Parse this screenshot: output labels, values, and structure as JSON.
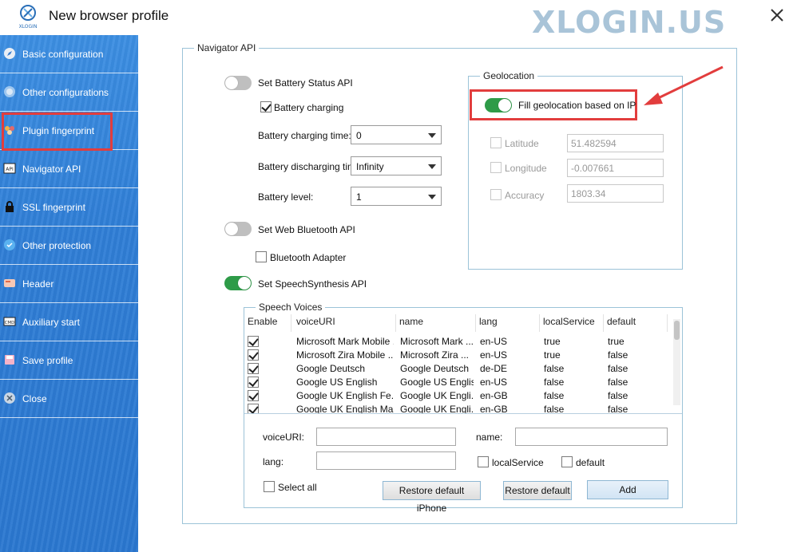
{
  "window": {
    "title": "New browser profile",
    "brand": "XLOGIN.US",
    "logo_text": "XLOGIN"
  },
  "sidebar": {
    "items": [
      {
        "label": "Basic configuration",
        "icon": "compass-icon"
      },
      {
        "label": "Other configurations",
        "icon": "puzzle-icon"
      },
      {
        "label": "Plugin fingerprint",
        "icon": "plugin-icon"
      },
      {
        "label": "Navigator API",
        "icon": "api-icon"
      },
      {
        "label": "SSL fingerprint",
        "icon": "lock-icon"
      },
      {
        "label": "Other protection",
        "icon": "shield-icon"
      },
      {
        "label": "Header",
        "icon": "header-icon"
      },
      {
        "label": "Auxiliary start",
        "icon": "cmd-icon"
      },
      {
        "label": "Save profile",
        "icon": "save-icon"
      },
      {
        "label": "Close",
        "icon": "close-icon"
      }
    ],
    "active": "Navigator API"
  },
  "navigator": {
    "legend": "Navigator API",
    "battery_status_label": "Set Battery Status API",
    "battery_status_on": false,
    "battery_charging_label": "Battery charging",
    "battery_charging_checked": true,
    "charging_time_label": "Battery charging time:",
    "charging_time_value": "0",
    "discharging_time_label": "Battery discharging time",
    "discharging_time_value": "Infinity",
    "battery_level_label": "Battery level:",
    "battery_level_value": "1",
    "bluetooth_label": "Set Web Bluetooth API",
    "bluetooth_on": false,
    "bluetooth_adapter_label": "Bluetooth Adapter",
    "bluetooth_adapter_checked": false,
    "speech_label": "Set SpeechSynthesis API",
    "speech_on": true
  },
  "geolocation": {
    "legend": "Geolocation",
    "fill_label": "Fill geolocation based on IP",
    "fill_on": true,
    "latitude_label": "Latitude",
    "latitude_value": "51.482594",
    "longitude_label": "Longitude",
    "longitude_value": "-0.007661",
    "accuracy_label": "Accuracy",
    "accuracy_value": "1803.34"
  },
  "voices": {
    "legend": "Speech Voices",
    "columns": [
      "Enable",
      "voiceURI",
      "name",
      "lang",
      "localService",
      "default"
    ],
    "rows": [
      {
        "enabled": true,
        "voiceURI": "Microsoft Mark Mobile ...",
        "name": "Microsoft Mark ...",
        "lang": "en-US",
        "localService": "true",
        "default": "true"
      },
      {
        "enabled": true,
        "voiceURI": "Microsoft Zira Mobile ...",
        "name": "Microsoft Zira ...",
        "lang": "en-US",
        "localService": "true",
        "default": "false"
      },
      {
        "enabled": true,
        "voiceURI": "Google Deutsch",
        "name": "Google Deutsch",
        "lang": "de-DE",
        "localService": "false",
        "default": "false"
      },
      {
        "enabled": true,
        "voiceURI": "Google US English",
        "name": "Google US English",
        "lang": "en-US",
        "localService": "false",
        "default": "false"
      },
      {
        "enabled": true,
        "voiceURI": "Google UK English Fe...",
        "name": "Google UK Engli...",
        "lang": "en-GB",
        "localService": "false",
        "default": "false"
      },
      {
        "enabled": true,
        "voiceURI": "Google UK English Male",
        "name": "Google UK Engli...",
        "lang": "en-GB",
        "localService": "false",
        "default": "false"
      }
    ],
    "form": {
      "voiceuri_label": "voiceURI:",
      "name_label": "name:",
      "lang_label": "lang:",
      "local_service_label": "localService",
      "default_label": "default",
      "select_all_label": "Select all",
      "restore_iphone_label": "Restore default iPhone",
      "restore_default_label": "Restore default",
      "add_label": "Add"
    }
  },
  "colors": {
    "sidebar": "#2f7ed6",
    "toggle_on": "#2e9b48",
    "toggle_off": "#bfbfbf",
    "highlight": "#e23d3d",
    "brand": "#a9c4d8"
  }
}
